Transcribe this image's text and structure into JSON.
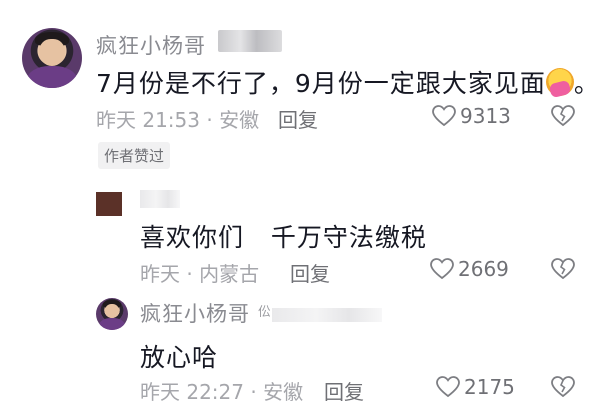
{
  "comments": [
    {
      "username": "疯狂小杨哥",
      "text": "7月份是不行了，9月份一定跟大家见面",
      "text_suffix": "。",
      "meta": "昨天 21:53 · 安徽",
      "reply_label": "回复",
      "like_count": "9313",
      "badge": "作者赞过"
    },
    {
      "username": "",
      "text": "喜欢你们   千万守法缴税",
      "meta": "昨天 · 内蒙古",
      "reply_label": "回复",
      "like_count": "2669"
    },
    {
      "username": "疯狂小杨哥",
      "username_extra": "伀",
      "text": "放心哈",
      "meta": "昨天 22:27 · 安徽",
      "reply_label": "回复",
      "like_count": "2175"
    }
  ],
  "icons": {
    "like": "heart-outline-icon",
    "dislike": "broken-heart-icon",
    "emoji": "hugging-face-emoji"
  }
}
